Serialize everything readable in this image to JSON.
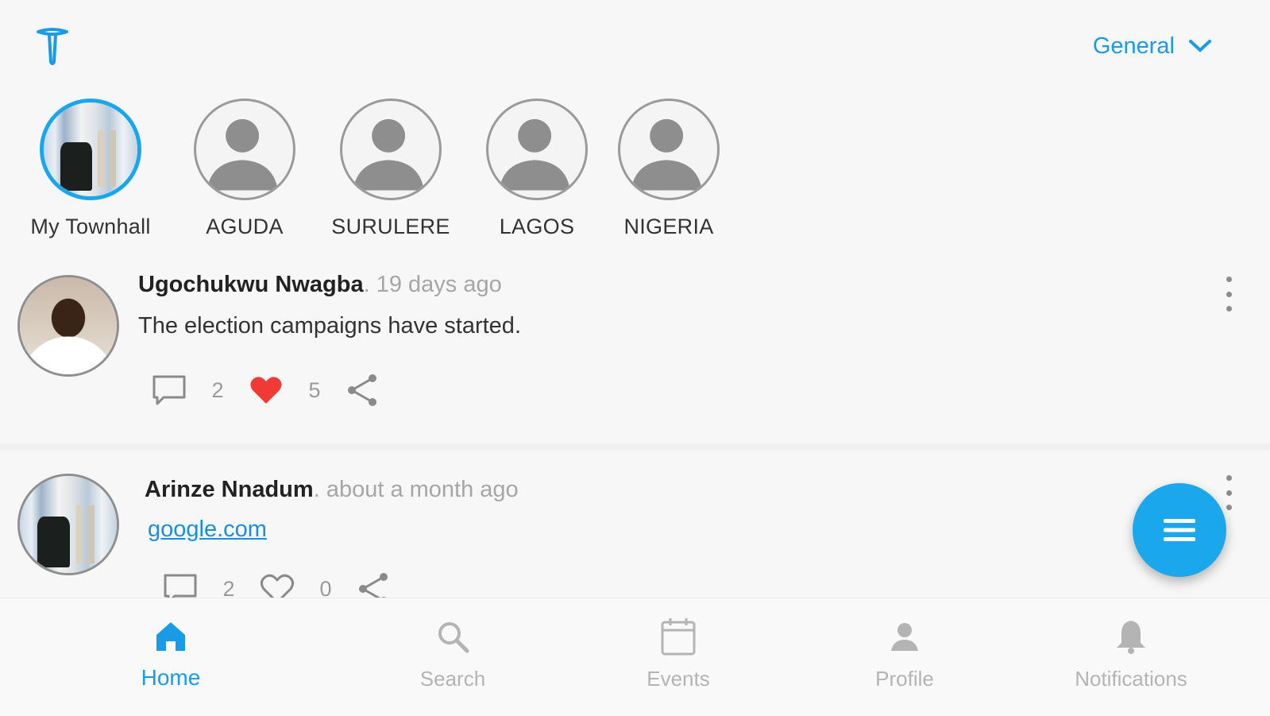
{
  "header": {
    "logo_icon": "townhall-logo-icon",
    "scope_label": "General",
    "scope_icon": "chevron-down-icon"
  },
  "stories": [
    {
      "label": "My Townhall",
      "active": true
    },
    {
      "label": "AGUDA",
      "active": false
    },
    {
      "label": "SURULERE",
      "active": false
    },
    {
      "label": "LAGOS",
      "active": false
    },
    {
      "label": "NIGERIA",
      "active": false
    }
  ],
  "posts": [
    {
      "author": "Ugochukwu Nwagba",
      "separator": ".",
      "time": "19 days ago",
      "body": "The election campaigns have started.",
      "is_link": false,
      "comments": "2",
      "likes": "5",
      "liked": true
    },
    {
      "author": "Arinze Nnadum",
      "separator": ".",
      "time": "about a month ago",
      "body": "google.com",
      "is_link": true,
      "comments": "2",
      "likes": "0",
      "liked": false
    }
  ],
  "fab": {
    "icon": "menu-icon"
  },
  "tabs": [
    {
      "label": "Home",
      "icon": "home-icon",
      "active": true
    },
    {
      "label": "Search",
      "icon": "search-icon",
      "active": false
    },
    {
      "label": "Events",
      "icon": "calendar-icon",
      "active": false
    },
    {
      "label": "Profile",
      "icon": "person-icon",
      "active": false
    },
    {
      "label": "Notifications",
      "icon": "bell-icon",
      "active": false
    }
  ],
  "colors": {
    "accent": "#1a9be8",
    "fab": "#1aa7ec",
    "like": "#f03a36",
    "background": "#f7f7f7"
  }
}
